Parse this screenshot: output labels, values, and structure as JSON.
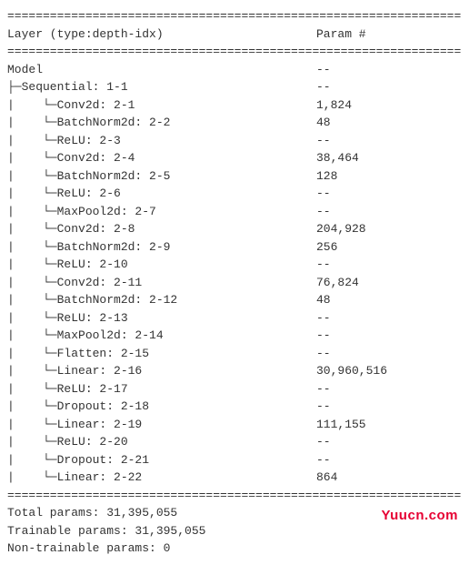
{
  "header": {
    "layer_col": "Layer (type:depth-idx)",
    "param_col": "Param #"
  },
  "separator": "================================================================",
  "rows": [
    {
      "indent": "",
      "prefix": "",
      "name": "Model",
      "param": "--"
    },
    {
      "indent": "",
      "prefix": "├─",
      "name": "Sequential: 1-1",
      "param": "--"
    },
    {
      "indent": "|    ",
      "prefix": "└─",
      "name": "Conv2d: 2-1",
      "param": "1,824"
    },
    {
      "indent": "|    ",
      "prefix": "└─",
      "name": "BatchNorm2d: 2-2",
      "param": "48"
    },
    {
      "indent": "|    ",
      "prefix": "└─",
      "name": "ReLU: 2-3",
      "param": "--"
    },
    {
      "indent": "|    ",
      "prefix": "└─",
      "name": "Conv2d: 2-4",
      "param": "38,464"
    },
    {
      "indent": "|    ",
      "prefix": "└─",
      "name": "BatchNorm2d: 2-5",
      "param": "128"
    },
    {
      "indent": "|    ",
      "prefix": "└─",
      "name": "ReLU: 2-6",
      "param": "--"
    },
    {
      "indent": "|    ",
      "prefix": "└─",
      "name": "MaxPool2d: 2-7",
      "param": "--"
    },
    {
      "indent": "|    ",
      "prefix": "└─",
      "name": "Conv2d: 2-8",
      "param": "204,928"
    },
    {
      "indent": "|    ",
      "prefix": "└─",
      "name": "BatchNorm2d: 2-9",
      "param": "256"
    },
    {
      "indent": "|    ",
      "prefix": "└─",
      "name": "ReLU: 2-10",
      "param": "--"
    },
    {
      "indent": "|    ",
      "prefix": "└─",
      "name": "Conv2d: 2-11",
      "param": "76,824"
    },
    {
      "indent": "|    ",
      "prefix": "└─",
      "name": "BatchNorm2d: 2-12",
      "param": "48"
    },
    {
      "indent": "|    ",
      "prefix": "└─",
      "name": "ReLU: 2-13",
      "param": "--"
    },
    {
      "indent": "|    ",
      "prefix": "└─",
      "name": "MaxPool2d: 2-14",
      "param": "--"
    },
    {
      "indent": "|    ",
      "prefix": "└─",
      "name": "Flatten: 2-15",
      "param": "--"
    },
    {
      "indent": "|    ",
      "prefix": "└─",
      "name": "Linear: 2-16",
      "param": "30,960,516"
    },
    {
      "indent": "|    ",
      "prefix": "└─",
      "name": "ReLU: 2-17",
      "param": "--"
    },
    {
      "indent": "|    ",
      "prefix": "└─",
      "name": "Dropout: 2-18",
      "param": "--"
    },
    {
      "indent": "|    ",
      "prefix": "└─",
      "name": "Linear: 2-19",
      "param": "111,155"
    },
    {
      "indent": "|    ",
      "prefix": "└─",
      "name": "ReLU: 2-20",
      "param": "--"
    },
    {
      "indent": "|    ",
      "prefix": "└─",
      "name": "Dropout: 2-21",
      "param": "--"
    },
    {
      "indent": "|    ",
      "prefix": "└─",
      "name": "Linear: 2-22",
      "param": "864"
    }
  ],
  "footer": {
    "total": "Total params: 31,395,055",
    "trainable": "Trainable params: 31,395,055",
    "nontrainable": "Non-trainable params: 0"
  },
  "watermark": "Yuucn.com"
}
